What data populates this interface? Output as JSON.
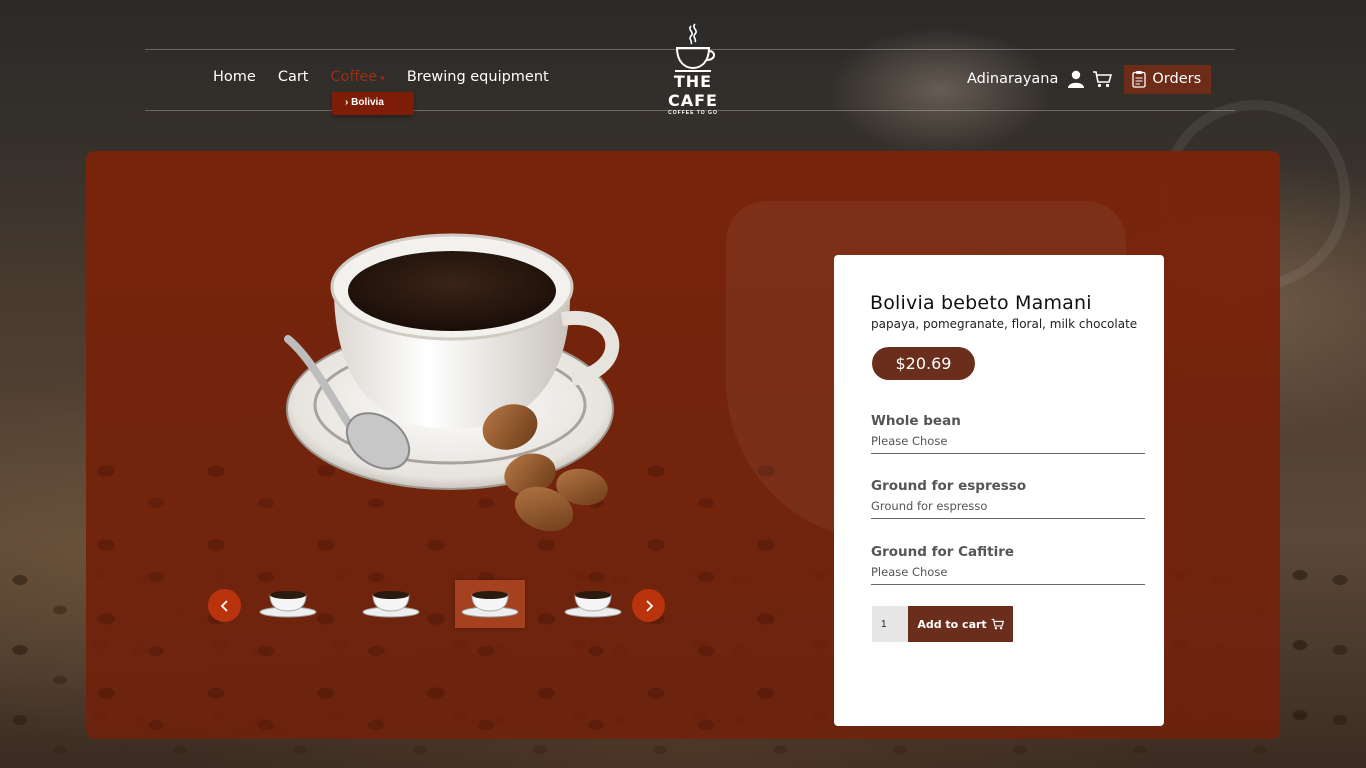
{
  "nav": {
    "items": [
      {
        "label": "Home"
      },
      {
        "label": "Cart"
      },
      {
        "label": "Coffee",
        "active": true
      },
      {
        "label": "Brewing equipment"
      }
    ],
    "submenu_item": "› Bolivia"
  },
  "logo": {
    "title": "THE CAFE",
    "subtitle": "COFFEE TO GO"
  },
  "user": {
    "name": "Adinarayana",
    "orders_label": "Orders"
  },
  "icons": {
    "user": "user-icon",
    "cart": "cart-icon",
    "orders": "clipboard-icon",
    "prev": "chevron-left-icon",
    "next": "chevron-right-icon"
  },
  "product": {
    "name": "Bolivia bebeto Mamani",
    "notes": "papaya, pomegranate, floral, milk chocolate",
    "price": "$20.69",
    "options": [
      {
        "label": "Whole bean",
        "value": "Please Chose"
      },
      {
        "label": "Ground for espresso",
        "value": "Ground for espresso"
      },
      {
        "label": "Ground for Cafitire",
        "value": "Please Chose"
      }
    ],
    "quantity": "1",
    "add_to_cart_label": "Add to cart"
  },
  "carousel": {
    "thumb_count": 4,
    "selected_index": 2
  },
  "colors": {
    "panel": "#7a240a",
    "accent": "#b9340d",
    "button": "#6b2e1c",
    "nav_active": "#9a2e12"
  }
}
